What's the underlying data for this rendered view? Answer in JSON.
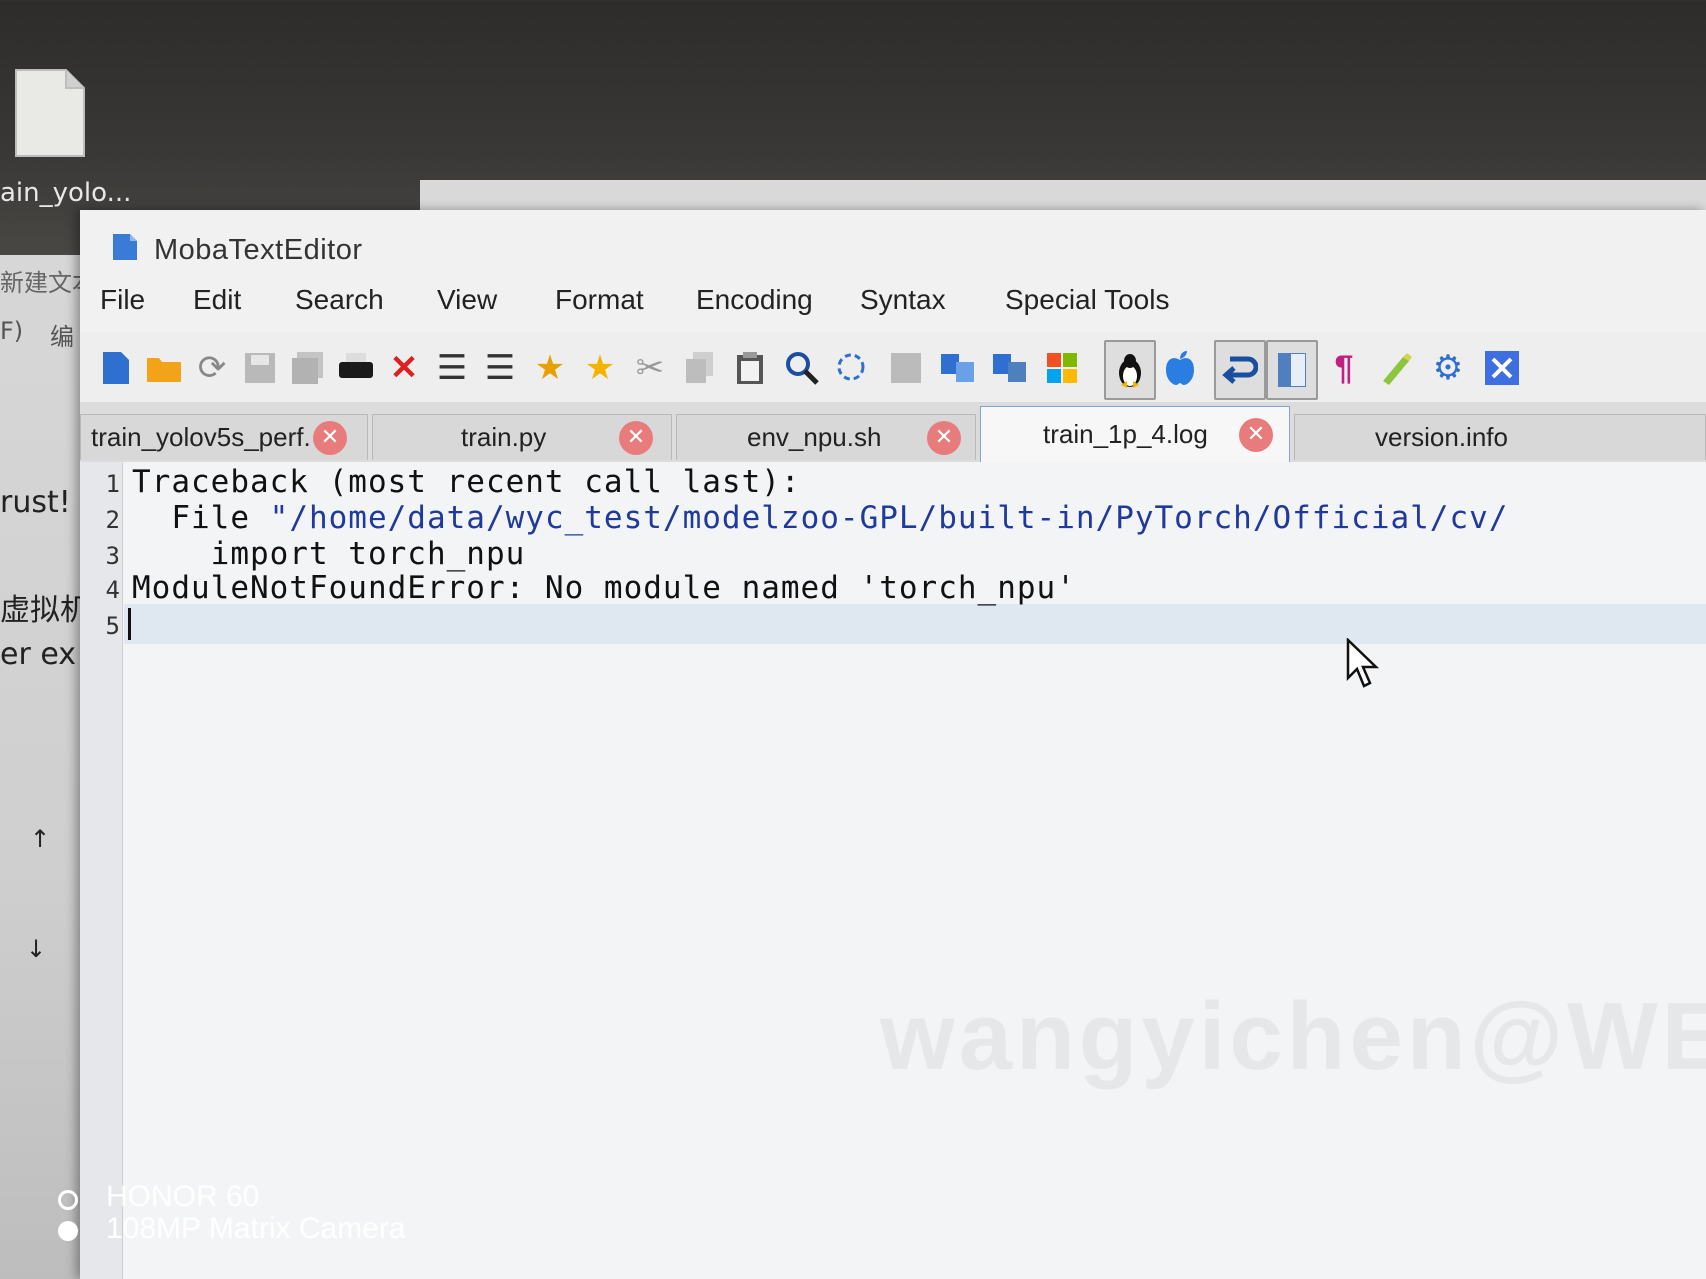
{
  "desktop": {
    "file_label": "ain_yolo...",
    "behind_window_fragments": [
      "新建文本",
      "F)",
      "编",
      "rust!",
      "虚拟机",
      "er ex",
      "↑",
      "↓"
    ]
  },
  "window": {
    "app_title": "MobaTextEditor"
  },
  "menu": [
    "File",
    "Edit",
    "Search",
    "View",
    "Format",
    "Encoding",
    "Syntax",
    "Special Tools"
  ],
  "toolbar": [
    {
      "name": "new-file-icon"
    },
    {
      "name": "open-folder-icon"
    },
    {
      "name": "reload-icon"
    },
    {
      "name": "save-icon"
    },
    {
      "name": "save-all-icon"
    },
    {
      "name": "print-icon"
    },
    {
      "name": "close-delete-icon"
    },
    {
      "name": "unindent-icon"
    },
    {
      "name": "indent-icon"
    },
    {
      "name": "bookmark-add-icon"
    },
    {
      "name": "bookmark-star-icon"
    },
    {
      "name": "cut-icon"
    },
    {
      "name": "copy-icon"
    },
    {
      "name": "paste-icon"
    },
    {
      "name": "search-icon"
    },
    {
      "name": "replace-icon"
    },
    {
      "name": "grid-icon"
    },
    {
      "name": "compare-icon"
    },
    {
      "name": "sync-icon"
    },
    {
      "name": "windows-icon"
    },
    {
      "name": "linux-icon",
      "pressed": true
    },
    {
      "name": "apple-icon"
    },
    {
      "name": "word-wrap-icon",
      "pressed": true
    },
    {
      "name": "split-view-icon",
      "pressed": true
    },
    {
      "name": "show-paragraph-icon"
    },
    {
      "name": "highlighter-icon"
    },
    {
      "name": "settings-icon"
    },
    {
      "name": "close-x-icon"
    }
  ],
  "tabs": [
    {
      "label": "train_yolov5s_perf...",
      "active": false
    },
    {
      "label": "train.py",
      "active": false
    },
    {
      "label": "env_npu.sh",
      "active": false
    },
    {
      "label": "train_1p_4.log",
      "active": true
    },
    {
      "label": "version.info",
      "active": false
    }
  ],
  "editor": {
    "line_numbers": [
      "1",
      "2",
      "3",
      "4",
      "5"
    ],
    "lines": [
      {
        "text": "Traceback (most recent call last):"
      },
      {
        "prefix": "  File ",
        "string": "\"/home/data/wyc_test/modelzoo-GPL/built-in/PyTorch/Official/cv/"
      },
      {
        "text": "    import torch_npu"
      },
      {
        "text": "ModuleNotFoundError: No module named 'torch_npu'"
      },
      {
        "text": ""
      }
    ],
    "watermark": "wangyichen@WEIC"
  },
  "camera_watermark": {
    "model": "HONOR 60",
    "camera": "108MP Matrix Camera"
  },
  "colors": {
    "string": "#1f3a9c",
    "tab_close": "#e87c7c",
    "active_tab_border": "#7fa3d6"
  }
}
